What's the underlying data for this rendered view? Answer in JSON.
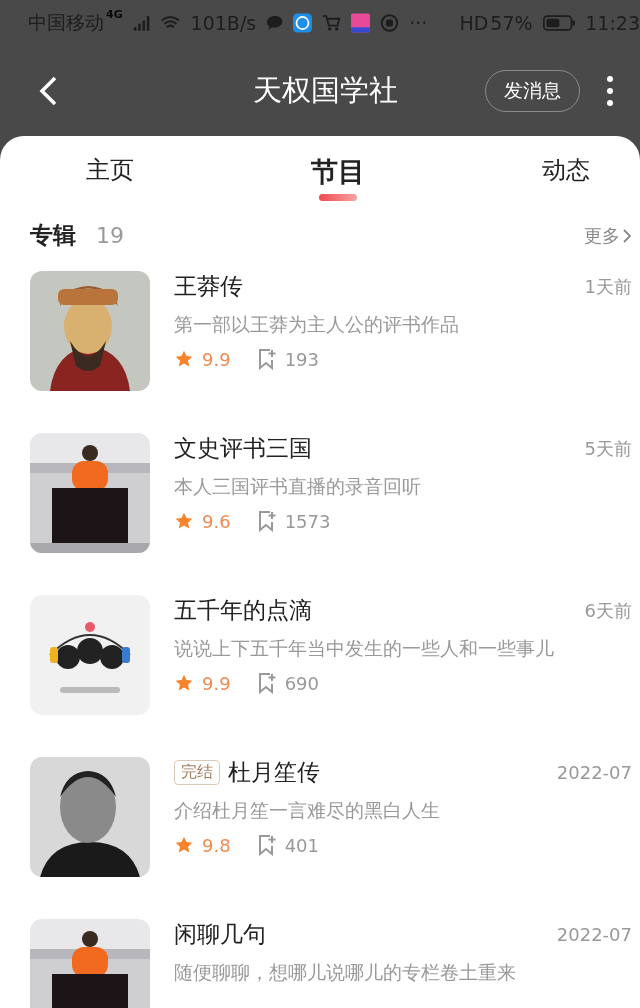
{
  "status_bar": {
    "carrier": "中国移动",
    "network": "4G",
    "speed": "101B/s",
    "more": "···",
    "hd": "HD",
    "battery": "57%",
    "time": "11:23"
  },
  "header": {
    "title": "天权国学社",
    "message_button": "发消息"
  },
  "tabs": [
    {
      "label": "主页",
      "selected": false
    },
    {
      "label": "节目",
      "selected": true
    },
    {
      "label": "动态",
      "selected": false
    }
  ],
  "section": {
    "title": "专辑",
    "count": "19",
    "more": "更多"
  },
  "albums": [
    {
      "title": "王莽传",
      "date": "1天前",
      "description": "第一部以王莽为主人公的评书作品",
      "rating": "9.9",
      "subscribers": "193"
    },
    {
      "title": "文史评书三国",
      "date": "5天前",
      "description": "本人三国评书直播的录音回听",
      "rating": "9.6",
      "subscribers": "1573"
    },
    {
      "title": "五千年的点滴",
      "date": "6天前",
      "description": "说说上下五千年当中发生的一些人和一些事儿",
      "rating": "9.9",
      "subscribers": "690"
    },
    {
      "badge": "完结",
      "title": "杜月笙传",
      "date": "2022-07",
      "description": "介绍杜月笙一言难尽的黑白人生",
      "rating": "9.8",
      "subscribers": "401"
    },
    {
      "title": "闲聊几句",
      "date": "2022-07",
      "description": "随便聊聊，想哪儿说哪儿的专栏卷土重来"
    }
  ]
}
